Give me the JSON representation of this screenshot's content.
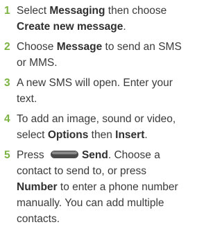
{
  "steps": [
    {
      "number": "1",
      "parts": [
        {
          "text": "Select ",
          "bold": false
        },
        {
          "text": "Messaging",
          "bold": true
        },
        {
          "text": " then choose ",
          "bold": false
        },
        {
          "text": "Create new message",
          "bold": true
        },
        {
          "text": ".",
          "bold": false
        }
      ]
    },
    {
      "number": "2",
      "parts": [
        {
          "text": "Choose ",
          "bold": false
        },
        {
          "text": "Message",
          "bold": true
        },
        {
          "text": " to send an SMS or MMS.",
          "bold": false
        }
      ]
    },
    {
      "number": "3",
      "parts": [
        {
          "text": "A new SMS will open. Enter your text.",
          "bold": false
        }
      ]
    },
    {
      "number": "4",
      "parts": [
        {
          "text": "To add an image, sound or video, select ",
          "bold": false
        },
        {
          "text": "Options",
          "bold": true
        },
        {
          "text": " then ",
          "bold": false
        },
        {
          "text": "Insert",
          "bold": true
        },
        {
          "text": ".",
          "bold": false
        }
      ]
    },
    {
      "number": "5",
      "parts": [
        {
          "text": "Press ",
          "bold": false
        },
        {
          "icon": "soft-key-icon"
        },
        {
          "text": "Send",
          "bold": true
        },
        {
          "text": ". Choose a contact to send to, or press ",
          "bold": false
        },
        {
          "text": "Number",
          "bold": true
        },
        {
          "text": " to enter a phone number manually. You can add multiple contacts.",
          "bold": false
        }
      ]
    }
  ],
  "colors": {
    "step_number": "#7cb342",
    "body_text": "#3a3a3a",
    "key_fill": "#4a4a4a"
  }
}
